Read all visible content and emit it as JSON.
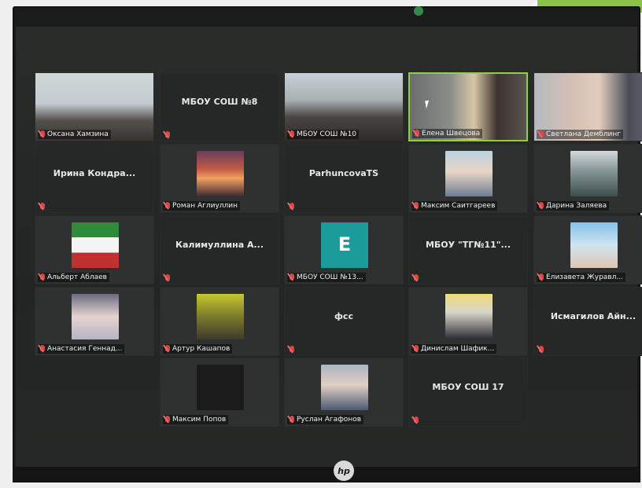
{
  "meeting": {
    "tiles": [
      {
        "kind": "video",
        "label": "Оксана Хамзина",
        "scene": "classroom1"
      },
      {
        "kind": "text",
        "label": "",
        "text": "МБОУ СОШ №8"
      },
      {
        "kind": "video",
        "label": "МБОУ СОШ №10",
        "scene": "classroom2"
      },
      {
        "kind": "video",
        "label": "Елена Швецова",
        "scene": "teacher",
        "active": true
      },
      {
        "kind": "video",
        "label": "Светлана Демблинг",
        "scene": "svetlana"
      },
      {
        "kind": "text",
        "label": "",
        "text": "Ирина Кондра..."
      },
      {
        "kind": "avatar",
        "label": "Роман Аглиуллин",
        "scene": "sunset"
      },
      {
        "kind": "text",
        "label": "",
        "text": "ParhuncovaTS"
      },
      {
        "kind": "avatar",
        "label": "Максим Саитгареев",
        "scene": "selfie1"
      },
      {
        "kind": "avatar",
        "label": "Дарина Заляева",
        "scene": "forest"
      },
      {
        "kind": "avatar",
        "label": "Альберт Аблаев",
        "scene": "flag"
      },
      {
        "kind": "text",
        "label": "",
        "text": "Калимуллина А..."
      },
      {
        "kind": "avatar",
        "label": "МБОУ СОШ №13...",
        "scene": "teal",
        "letter": "E"
      },
      {
        "kind": "text",
        "label": "",
        "text": "МБОУ \"ТГ№11\"..."
      },
      {
        "kind": "avatar",
        "label": "Елизавета Журавл...",
        "scene": "beach"
      },
      {
        "kind": "avatar",
        "label": "Анастасия Геннад...",
        "scene": "blonde"
      },
      {
        "kind": "avatar",
        "label": "Артур Кашапов",
        "scene": "yellow"
      },
      {
        "kind": "text",
        "label": "",
        "text": "фсс"
      },
      {
        "kind": "avatar",
        "label": "Динислам Шафик...",
        "scene": "suit"
      },
      {
        "kind": "text",
        "label": "",
        "text": "Исмагилов Айн..."
      },
      {
        "kind": "avatar",
        "label": "Максим Попов",
        "scene": "blank"
      },
      {
        "kind": "avatar",
        "label": "Руслан Агафонов",
        "scene": "boy"
      },
      {
        "kind": "text",
        "label": "",
        "text": "МБОУ СОШ 17"
      }
    ]
  },
  "device": {
    "brand": "hp"
  }
}
